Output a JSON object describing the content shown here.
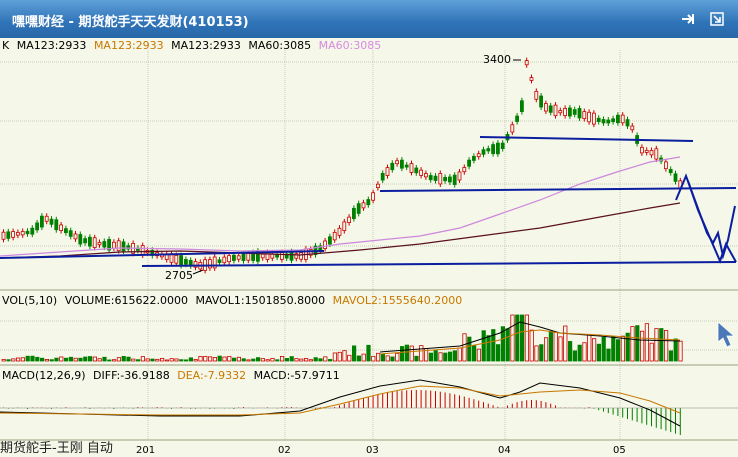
{
  "window": {
    "title": "嘿嘿财经 - 期货舵手天天发财(410153)"
  },
  "toolbar": {
    "pin_icon": "pin-icon",
    "restore_icon": "restore-icon"
  },
  "price_panel": {
    "label": "K",
    "ma": [
      {
        "text": "MA123:2933",
        "color": "#000000"
      },
      {
        "text": "MA123:2933",
        "color": "#c87800"
      },
      {
        "text": "MA123:2933",
        "color": "#000000"
      },
      {
        "text": "MA60:3085",
        "color": "#000000"
      },
      {
        "text": "MA60:3085",
        "color": "#d88ae0"
      }
    ],
    "high_label": "3400",
    "low_label": "2705"
  },
  "volume_panel": {
    "items": [
      {
        "text": "VOL(5,10)",
        "color": "#000000"
      },
      {
        "text": "VOLUME:615622.0000",
        "color": "#000000"
      },
      {
        "text": "MAVOL1:1501850.8000",
        "color": "#000000"
      },
      {
        "text": "MAVOL2:1555640.2000",
        "color": "#c87800"
      }
    ]
  },
  "macd_panel": {
    "items": [
      {
        "text": "MACD(12,26,9)",
        "color": "#000000"
      },
      {
        "text": "DIFF:-36.9188",
        "color": "#000000"
      },
      {
        "text": "DEA:-7.9332",
        "color": "#c87800"
      },
      {
        "text": "MACD:-57.9711",
        "color": "#000000"
      }
    ]
  },
  "x_axis": {
    "labels": [
      "201",
      "02",
      "03",
      "04",
      "05"
    ]
  },
  "watermark": "期货舵手-王刚  自动",
  "colors": {
    "up": "#cc0000",
    "down": "#008000",
    "trendline": "#0c1ea0",
    "ma_long": "#5a1020",
    "ma_mid": "#cc88dd",
    "title_bar": "#2f73b8"
  }
}
